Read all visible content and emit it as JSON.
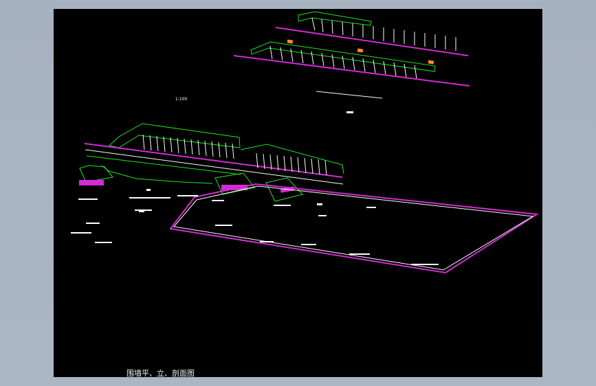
{
  "drawing": {
    "title": "围墙平、立、剖面图",
    "scale_label": "1:100"
  },
  "colors": {
    "background": "#000000",
    "frame": "#a9b4c2",
    "green": "#22e622",
    "magenta": "#d52bd5",
    "white": "#ffffff",
    "orange": "#ff8a2a"
  },
  "icons": {
    "drawing-area": "cad-model-space"
  }
}
